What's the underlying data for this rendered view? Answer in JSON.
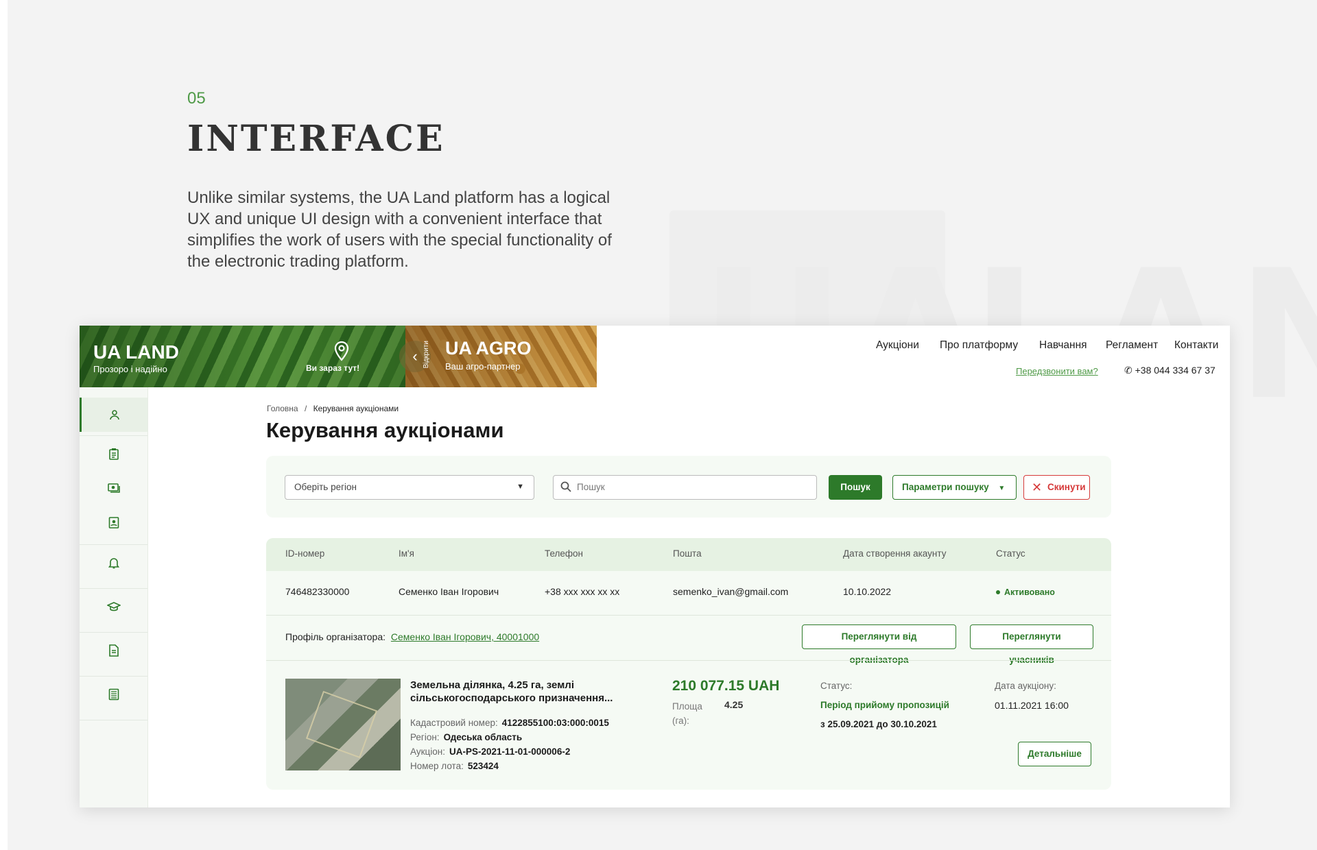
{
  "intro": {
    "number": "05",
    "title": "INTERFACE",
    "text": "Unlike similar systems, the UA Land platform has a logical UX and unique UI design with a convenient interface that simplifies the work of users with the special functionality of the electronic trading platform."
  },
  "header": {
    "brand1": "UA LAND",
    "brand1_sub": "Прозоро і надійно",
    "location": "Ви зараз тут!",
    "collapse_vertical": "Відкрити",
    "brand2": "UA AGRO",
    "brand2_sub": "Ваш агро-партнер",
    "nav": [
      "Аукціони",
      "Про платформу",
      "Навчання",
      "Регламент",
      "Контакти"
    ],
    "callback": "Передзвонити вам?",
    "phone": "+38 044 334 67 37"
  },
  "sidebar": {
    "icons": [
      "user-icon",
      "clipboard-icon",
      "money-icon",
      "id-card-icon",
      "bell-icon",
      "graduation-cap-icon",
      "document-icon",
      "list-icon"
    ]
  },
  "breadcrumb": {
    "home": "Головна",
    "separator": "/",
    "current": "Керування аукціонами"
  },
  "page_title": "Керування аукціонами",
  "filters": {
    "region_placeholder": "Оберіть регіон",
    "search_placeholder": "Пошук",
    "search_button": "Пошук",
    "params_button": "Параметри пошуку",
    "reset_button": "Скинути"
  },
  "table": {
    "headers": [
      "ID-номер",
      "Ім'я",
      "Телефон",
      "Пошта",
      "Дата створення акаунту",
      "Статус"
    ],
    "row": [
      "746482330000",
      "Семенко Іван Ігорович",
      "+38 xxx xxx xx xx",
      "semenko_ivan@gmail.com",
      "10.10.2022",
      "Активовано"
    ],
    "organizer_label": "Профіль організатора:",
    "organizer_link": "Семенко Іван Ігорович, 40001000",
    "view_organizer_btn": "Переглянути від організатора",
    "view_participants_btn": "Переглянути учасників"
  },
  "lot": {
    "title": "Земельна ділянка, 4.25 га, землі сільськогосподарського призначення...",
    "cadastral_label": "Кадастровий номер:",
    "cadastral_value": "4122855100:03:000:0015",
    "region_label": "Регіон:",
    "region_value": "Одеська область",
    "auction_label": "Аукціон:",
    "auction_value": "UA-PS-2021-11-01-000006-2",
    "lot_no_label": "Номер лота:",
    "lot_no_value": "523424",
    "price": "210 077.15 UAH",
    "area_label": "Площа (га):",
    "area_value": "4.25",
    "status_label": "Статус:",
    "status_value": "Період прийому пропозицій",
    "period": "з 25.09.2021  до 30.10.2021",
    "date_label": "Дата аукціону:",
    "date_value": "01.11.2021  16:00",
    "details_btn": "Детальніше"
  },
  "colors": {
    "accent": "#2d7a2a",
    "danger": "#d63a3a",
    "intro_number": "#4f9a47"
  }
}
